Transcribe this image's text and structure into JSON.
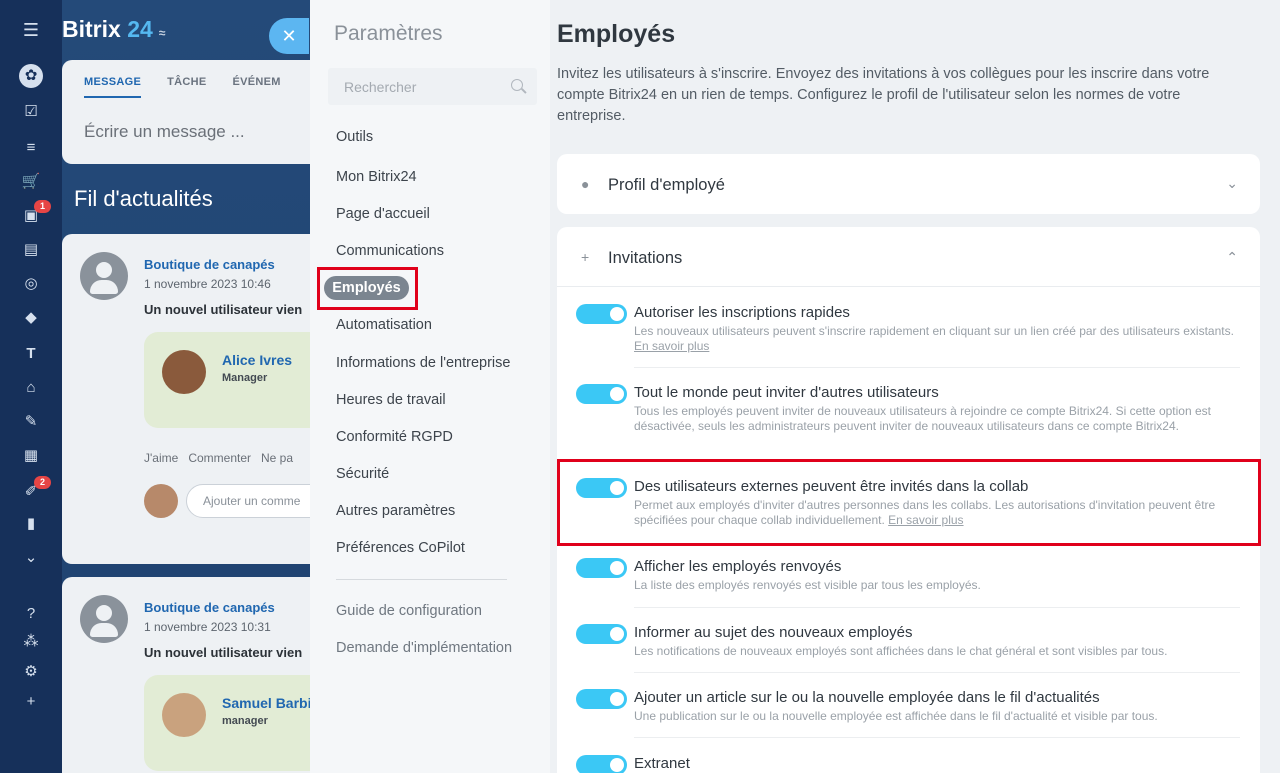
{
  "app": {
    "logo_name": "Bitrix",
    "logo_num": "24"
  },
  "rail": {
    "badges": [
      "1",
      "2"
    ]
  },
  "feed": {
    "composer_tabs": [
      "MESSAGE",
      "TÂCHE",
      "ÉVÉNEM"
    ],
    "composer_placeholder": "Écrire un message ...",
    "title": "Fil d'actualités",
    "posts": [
      {
        "author": "Boutique de canapés",
        "date": "1 novembre 2023 10:46",
        "message": "Un nouvel utilisateur vien",
        "card_name": "Alice Ivres",
        "card_role": "Manager",
        "actions": [
          "J'aime",
          "Commenter",
          "Ne pa"
        ],
        "comment_placeholder": "Ajouter un comme"
      },
      {
        "author": "Boutique de canapés",
        "date": "1 novembre 2023 10:31",
        "message": "Un nouvel utilisateur vien",
        "card_name": "Samuel Barbi",
        "card_role": "manager"
      }
    ]
  },
  "settings": {
    "title": "Paramètres",
    "search_placeholder": "Rechercher",
    "nav": [
      "Outils",
      "Mon Bitrix24",
      "Page d'accueil",
      "Communications",
      "Employés",
      "Automatisation",
      "Informations de l'entreprise",
      "Heures de travail",
      "Conformité RGPD",
      "Sécurité",
      "Autres paramètres",
      "Préférences CoPilot"
    ],
    "nav_secondary": [
      "Guide de configuration",
      "Demande d'implémentation"
    ]
  },
  "content": {
    "title": "Employés",
    "intro": "Invitez les utilisateurs à s'inscrire. Envoyez des invitations à vos collègues pour les inscrire dans votre compte Bitrix24 en un rien de temps. Configurez le profil de l'utilisateur selon les normes de votre entreprise.",
    "section_profile": "Profil d'employé",
    "section_invitations": "Invitations",
    "options": [
      {
        "label": "Autoriser les inscriptions rapides",
        "desc": "Les nouveaux utilisateurs peuvent s'inscrire rapidement en cliquant sur un lien créé par des utilisateurs existants.",
        "link": "En savoir plus",
        "on": true
      },
      {
        "label": "Tout le monde peut inviter d'autres utilisateurs",
        "desc": "Tous les employés peuvent inviter de nouveaux utilisateurs à rejoindre ce compte Bitrix24. Si cette option est désactivée, seuls les administrateurs peuvent inviter de nouveaux utilisateurs dans ce compte Bitrix24.",
        "on": true
      },
      {
        "label": "Des utilisateurs externes peuvent être invités dans la collab",
        "desc": "Permet aux employés d'inviter d'autres personnes dans les collabs. Les autorisations d'invitation peuvent être spécifiées pour chaque collab individuellement.",
        "link": "En savoir plus",
        "on": true
      },
      {
        "label": "Afficher les employés renvoyés",
        "desc": "La liste des employés renvoyés est visible par tous les employés.",
        "on": true
      },
      {
        "label": "Informer au sujet des nouveaux employés",
        "desc": "Les notifications de nouveaux employés sont affichées dans le chat général et sont visibles par tous.",
        "on": true
      },
      {
        "label": "Ajouter un article sur le ou la nouvelle employée dans le fil d'actualités",
        "desc": "Une publication sur le ou la nouvelle employée est affichée dans le fil d'actualité et visible par tous.",
        "on": true
      },
      {
        "label": "Extranet",
        "desc": "",
        "on": true
      }
    ]
  },
  "colors": {
    "accent_blue": "#2067b0",
    "toggle_on": "#3bc8f5",
    "highlight_red": "#e0001b",
    "rail_bg": "#16305a"
  }
}
